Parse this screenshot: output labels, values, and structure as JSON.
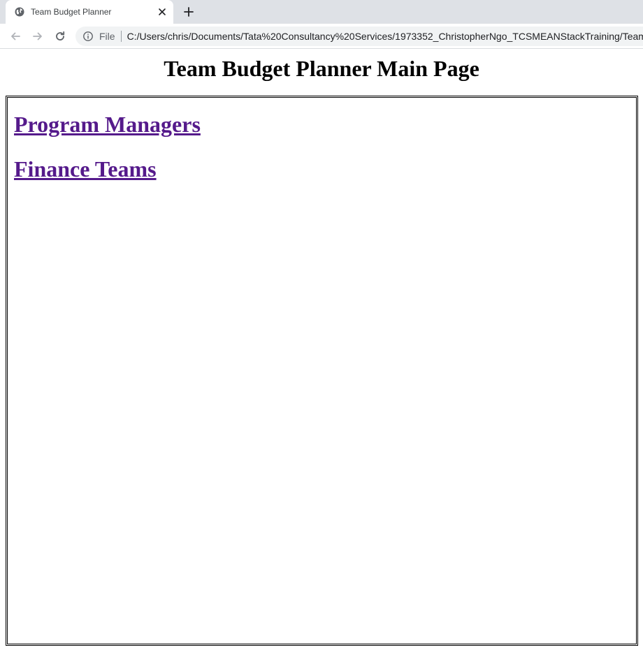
{
  "browser": {
    "tab": {
      "title": "Team Budget Planner",
      "favicon_icon": "globe-icon",
      "close_icon": "close-icon"
    },
    "new_tab_icon": "plus-icon",
    "nav": {
      "back_icon": "arrow-left-icon",
      "forward_icon": "arrow-right-icon",
      "reload_icon": "reload-icon"
    },
    "omnibox": {
      "info_icon": "info-icon",
      "scheme_label": "File",
      "url": "C:/Users/chris/Documents/Tata%20Consultancy%20Services/1973352_ChristopherNgo_TCSMEANStackTraining/Team%20"
    }
  },
  "page": {
    "title": "Team Budget Planner Main Page",
    "links": [
      {
        "label": "Program Managers"
      },
      {
        "label": "Finance Teams"
      }
    ]
  },
  "colors": {
    "visited_link": "#551a8b",
    "tabstrip_bg": "#dee1e6",
    "omnibox_bg": "#f1f3f4"
  }
}
